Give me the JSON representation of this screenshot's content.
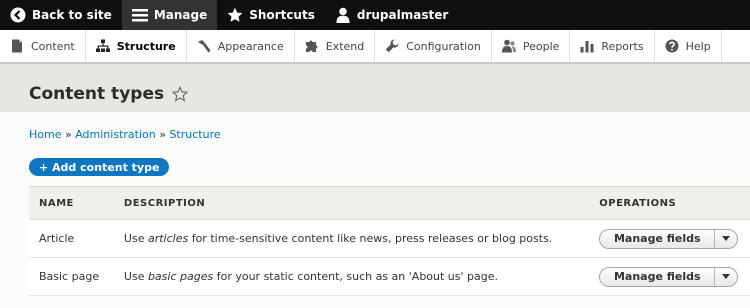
{
  "toolbar": {
    "back_label": "Back to site",
    "manage_label": "Manage",
    "shortcuts_label": "Shortcuts",
    "user_label": "drupalmaster"
  },
  "tray": {
    "items": [
      {
        "label": "Content",
        "icon": "page-icon"
      },
      {
        "label": "Structure",
        "icon": "sitemap-icon"
      },
      {
        "label": "Appearance",
        "icon": "paintbrush-icon"
      },
      {
        "label": "Extend",
        "icon": "puzzle-icon"
      },
      {
        "label": "Configuration",
        "icon": "wrench-icon"
      },
      {
        "label": "People",
        "icon": "people-icon"
      },
      {
        "label": "Reports",
        "icon": "bar-chart-icon"
      },
      {
        "label": "Help",
        "icon": "help-icon"
      }
    ],
    "active": "Structure"
  },
  "page": {
    "title": "Content types"
  },
  "breadcrumb": {
    "items": [
      "Home",
      "Administration",
      "Structure"
    ],
    "separator": "»"
  },
  "add_button": {
    "label": "+ Add content type"
  },
  "table": {
    "headers": [
      "NAME",
      "DESCRIPTION",
      "OPERATIONS"
    ],
    "rows": [
      {
        "name": "Article",
        "desc_pre": "Use ",
        "desc_em": "articles",
        "desc_post": " for time-sensitive content like news, press releases or blog posts.",
        "operation": "Manage fields"
      },
      {
        "name": "Basic page",
        "desc_pre": "Use ",
        "desc_em": "basic pages",
        "desc_post": " for your static content, such as an 'About us' page.",
        "operation": "Manage fields"
      }
    ]
  },
  "colors": {
    "toolbar_bg": "#0f0f0f",
    "link": "#0074bd",
    "primary_button": "#0d77c4"
  }
}
